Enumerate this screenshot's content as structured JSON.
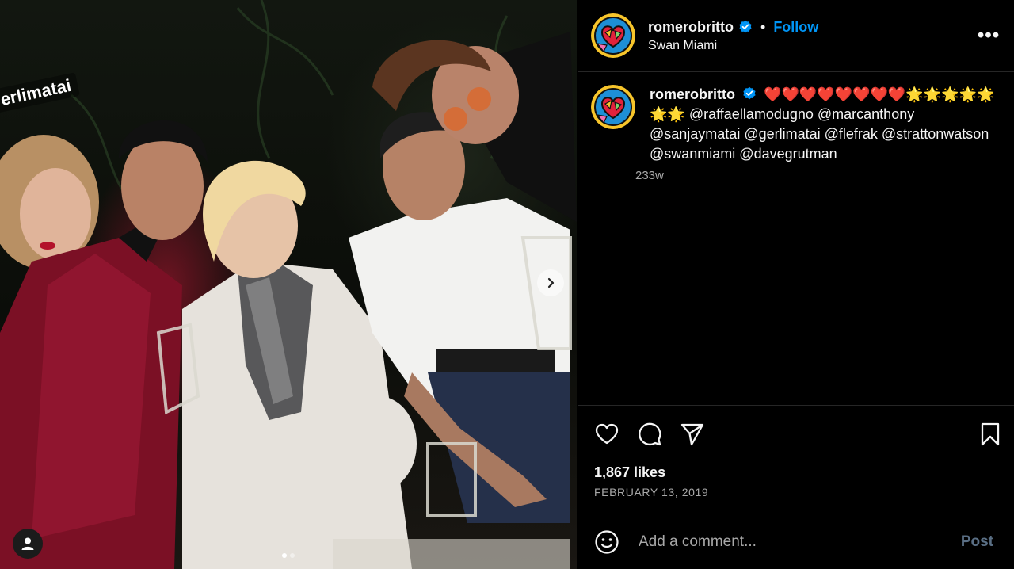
{
  "post": {
    "username": "romerobritto",
    "location": "Swan Miami",
    "follow_label": "Follow",
    "separator": "•",
    "more_label": "•••",
    "photo_tag_text": "erlimatai",
    "caption": {
      "username": "romerobritto",
      "emojis": "❤️❤️❤️❤️❤️❤️❤️❤️🌟🌟🌟🌟🌟🌟🌟",
      "mentions": "@raffaellamodugno @marcanthony @sanjaymatai @gerlimatai @flefrak @strattonwatson @swanmiami @davegrutman",
      "age": "233w"
    },
    "likes": "1,867 likes",
    "date": "FEBRUARY 13, 2019",
    "comment_placeholder": "Add a comment...",
    "post_label": "Post"
  },
  "colors": {
    "accent": "#0095f6",
    "background": "#000000",
    "divider": "#262626",
    "muted_text": "#a8a8a8",
    "post_disabled": "#5a6f85"
  },
  "icons": [
    "verified-badge-icon",
    "more-options-icon",
    "heart-icon",
    "comment-icon",
    "share-icon",
    "bookmark-icon",
    "emoji-icon",
    "chevron-right-icon",
    "user-tag-icon"
  ]
}
